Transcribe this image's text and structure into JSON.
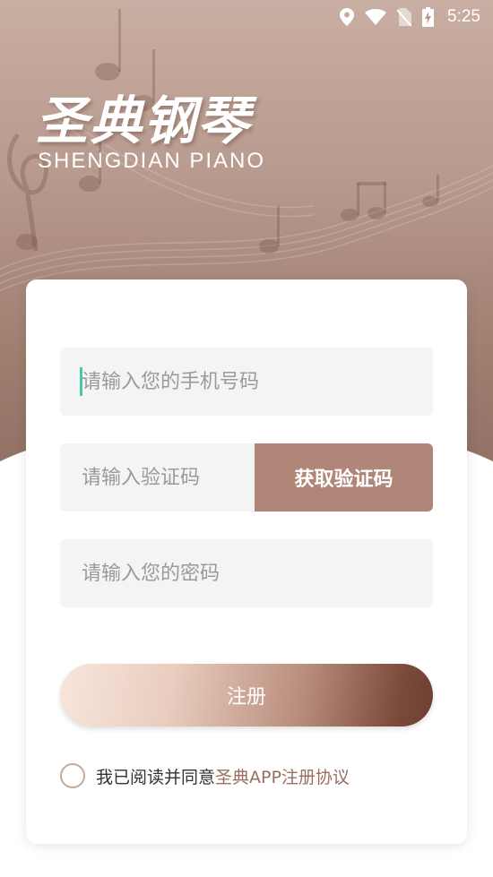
{
  "status_bar": {
    "time": "5:25",
    "icons": [
      "location-icon",
      "wifi-icon",
      "no-sim-icon",
      "battery-charging-icon"
    ]
  },
  "brand": {
    "title_cn": "圣典钢琴",
    "title_en": "SHENGDIAN PIANO"
  },
  "form": {
    "phone_placeholder": "请输入您的手机号码",
    "phone_value": "",
    "code_placeholder": "请输入验证码",
    "code_value": "",
    "get_code_label": "获取验证码",
    "password_placeholder": "请输入您的密码",
    "password_value": ""
  },
  "register_label": "注册",
  "agreement": {
    "checked": false,
    "text": "我已阅读并同意",
    "link": "圣典APP注册协议"
  },
  "colors": {
    "accent": "#b08679",
    "link": "#9a6e60",
    "caret": "#48c7a9"
  }
}
